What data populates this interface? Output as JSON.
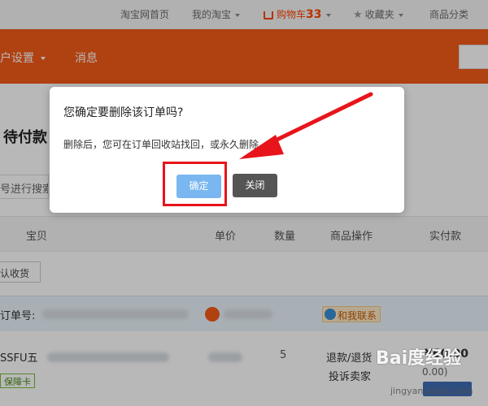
{
  "topbar": {
    "home": "淘宝网首页",
    "my_taobao": "我的淘宝",
    "cart_label": "购物车",
    "cart_count": "33",
    "favorites": "收藏夹",
    "categories": "商品分类"
  },
  "nav": {
    "account_settings": "户设置",
    "messages": "消息"
  },
  "page": {
    "pending_title": "待付款",
    "search_orders": "号进行搜索",
    "confirm_receipt": "认收货"
  },
  "table": {
    "headers": [
      "宝贝",
      "单价",
      "数量",
      "商品操作",
      "实付款"
    ]
  },
  "order": {
    "order_no_label": "订单号:",
    "chat_label": "和我联系",
    "product_name_prefix": "SSFU五",
    "guarantee_label": "保障卡",
    "qty_fragment": "5",
    "refund_label": "退款/退货",
    "complain_label": "投诉卖家",
    "price": "¥60.00",
    "price_note": "0.00)"
  },
  "modal": {
    "title": "您确定要删除该订单吗?",
    "body": "删除后，您可在订单回收站找回，或永久删除。",
    "ok_label": "确定",
    "close_label": "关闭"
  },
  "annotation": {
    "highlight_color": "#e8141b",
    "arrow_color": "#e8141b"
  },
  "watermark": {
    "logo": "Bai度经验",
    "url": "jingyan.baidu.com"
  },
  "colors": {
    "nav_orange": "#f45a18",
    "ok_button": "#7ab6ef",
    "close_button": "#555555"
  }
}
